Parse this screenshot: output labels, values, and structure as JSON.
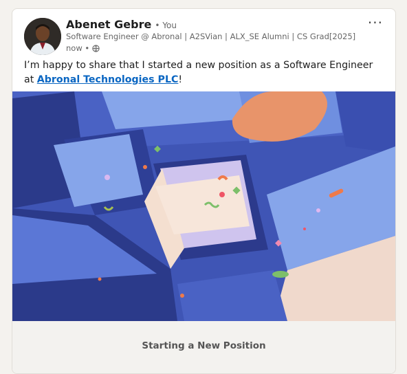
{
  "post": {
    "author_name": "Abenet Gebre",
    "author_badge": "• You",
    "headline": "Software Engineer @ Abronal | A2SVian | ALX_SE Alumni | CS Grad[2025]",
    "time": "now •",
    "more_label": "···",
    "text_before": "I’m happy to share that I started a new position as a Software Engineer at ",
    "company_link": "Abronal Technologies PLC",
    "text_after": "!",
    "media_caption": "Starting a New Position"
  },
  "icons": {
    "visibility": "globe-icon",
    "avatar": "profile-photo"
  },
  "colors": {
    "link": "#0a66c2",
    "keyboard": "#3f55b5",
    "key_top": "#86a5ea",
    "card_bg": "#ffffff"
  }
}
